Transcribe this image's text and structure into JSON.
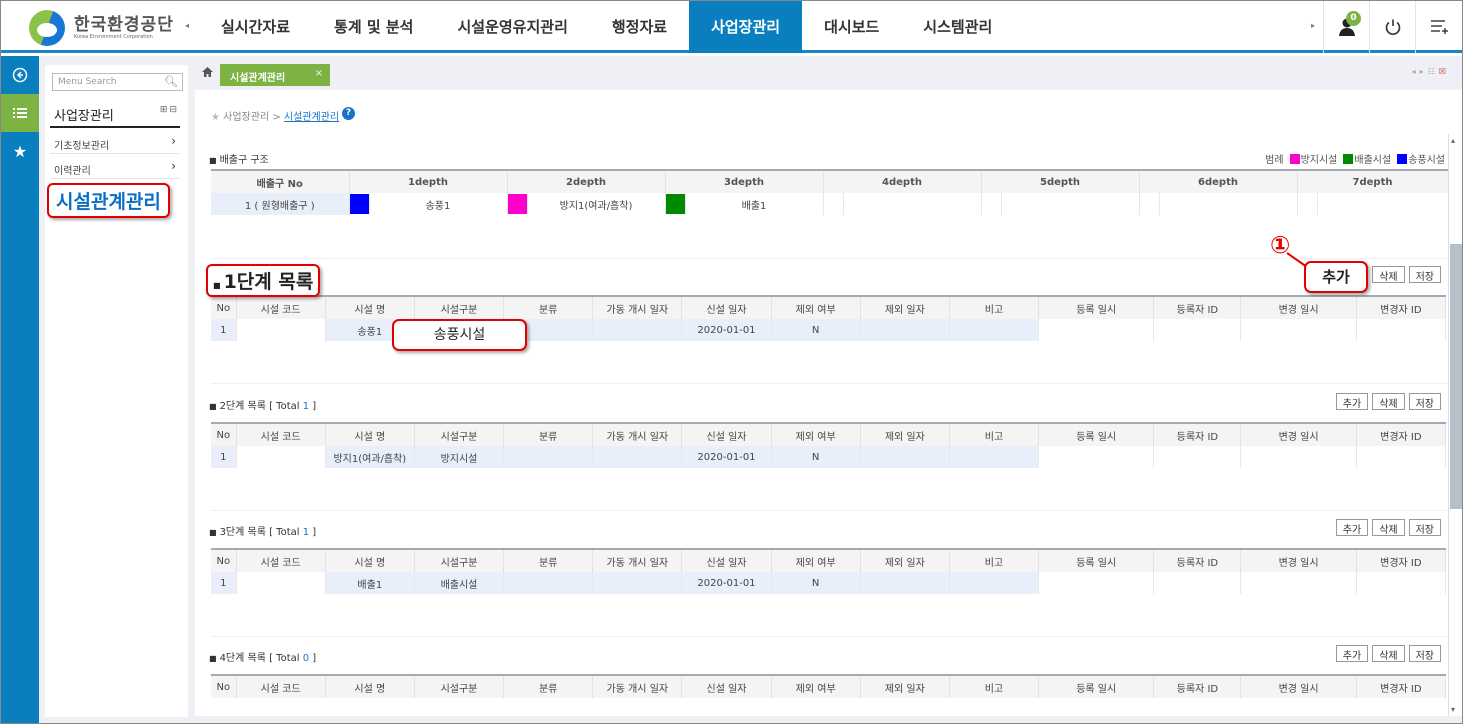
{
  "header": {
    "logo_ko": "한국환경공단",
    "logo_en": "Korea Environment Corporation",
    "nav_prev_icon": "◂",
    "nav_next_icon": "▸",
    "menu": [
      {
        "label": "실시간자료",
        "active": false
      },
      {
        "label": "통계 및 분석",
        "active": false
      },
      {
        "label": "시설운영유지관리",
        "active": false
      },
      {
        "label": "행정자료",
        "active": false
      },
      {
        "label": "사업장관리",
        "active": true
      },
      {
        "label": "대시보드",
        "active": false
      },
      {
        "label": "시스템관리",
        "active": false
      }
    ],
    "notification_count": "0",
    "accent_color": "#0a7fc0"
  },
  "left_strip": {
    "icons": [
      "back-icon",
      "menu-list-icon",
      "favorites-star-icon"
    ]
  },
  "sidebar": {
    "search_placeholder": "Menu Search",
    "title": "사업장관리",
    "items": [
      {
        "label": "기초정보관리"
      },
      {
        "label": "이력관리"
      }
    ],
    "highlighted_item": "시설관계관리"
  },
  "tabbar": {
    "tab_label": "시설관계관리",
    "tab_close": "×"
  },
  "breadcrumb": {
    "parent": "사업장관리",
    "separator": ">",
    "current": "시설관계관리",
    "help": "?"
  },
  "structure": {
    "title": "배출구 구조",
    "legend_label": "범례",
    "legend": [
      {
        "label": "방지시설",
        "color": "#ff00cc"
      },
      {
        "label": "배출시설",
        "color": "#008a00"
      },
      {
        "label": "송풍시설",
        "color": "#0000ff"
      }
    ],
    "headers": [
      "배출구 No",
      "1depth",
      "2depth",
      "3depth",
      "4depth",
      "5depth",
      "6depth",
      "7depth"
    ],
    "row": {
      "no": "1 ( 원형배출구 )",
      "depths": [
        {
          "color": "#0000ff",
          "name": "송풍1"
        },
        {
          "color": "#ff00cc",
          "name": "방지1(여과/흡착)"
        },
        {
          "color": "#008a00",
          "name": "배출1"
        },
        {
          "color": "",
          "name": ""
        },
        {
          "color": "",
          "name": ""
        },
        {
          "color": "",
          "name": ""
        },
        {
          "color": "",
          "name": ""
        }
      ]
    }
  },
  "buttons": {
    "add": "추가",
    "delete": "삭제",
    "save": "저장"
  },
  "columns": [
    "No",
    "시설 코드",
    "시설 명",
    "시설구분",
    "분류",
    "가동 개시 일자",
    "신설 일자",
    "제외 여부",
    "제외 일자",
    "비고",
    "등록 일시",
    "등록자 ID",
    "변경 일시",
    "변경자 ID"
  ],
  "lists": [
    {
      "title": "1단계 목록",
      "total_prefix": "",
      "total": "",
      "total_suffix": "",
      "rows": [
        {
          "no": "1",
          "code": "",
          "name": "송풍1",
          "type": "송풍시설",
          "category": "",
          "start_date": "",
          "new_date": "2020-01-01",
          "excluded": "N",
          "exclude_date": "",
          "note": "",
          "reg_date": "",
          "reg_id": "",
          "mod_date": "",
          "mod_id": ""
        }
      ]
    },
    {
      "title": "2단계 목록",
      "total_prefix": " [ Total ",
      "total": "1",
      "total_suffix": " ]",
      "rows": [
        {
          "no": "1",
          "code": "",
          "name": "방지1(여과/흡착)",
          "type": "방지시설",
          "category": "",
          "start_date": "",
          "new_date": "2020-01-01",
          "excluded": "N",
          "exclude_date": "",
          "note": "",
          "reg_date": "",
          "reg_id": "",
          "mod_date": "",
          "mod_id": ""
        }
      ]
    },
    {
      "title": "3단계 목록",
      "total_prefix": " [ Total ",
      "total": "1",
      "total_suffix": " ]",
      "rows": [
        {
          "no": "1",
          "code": "",
          "name": "배출1",
          "type": "배출시설",
          "category": "",
          "start_date": "",
          "new_date": "2020-01-01",
          "excluded": "N",
          "exclude_date": "",
          "note": "",
          "reg_date": "",
          "reg_id": "",
          "mod_date": "",
          "mod_id": ""
        }
      ]
    },
    {
      "title": "4단계 목록",
      "total_prefix": " [ Total ",
      "total": "0",
      "total_suffix": " ]",
      "rows": []
    }
  ],
  "annotations": {
    "marker": "①",
    "step1_title": "1단계 목록",
    "cell_callout": "송풍시설",
    "add_callout": "추가"
  }
}
